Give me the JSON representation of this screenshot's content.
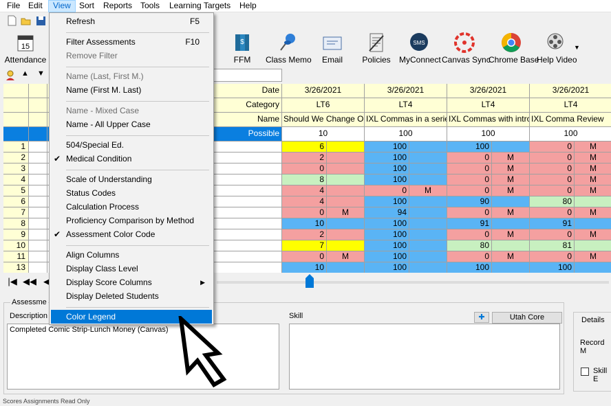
{
  "menubar": {
    "items": [
      {
        "label": "File",
        "active": false
      },
      {
        "label": "Edit",
        "active": false
      },
      {
        "label": "View",
        "active": true
      },
      {
        "label": "Sort",
        "active": false
      },
      {
        "label": "Reports",
        "active": false
      },
      {
        "label": "Tools",
        "active": false
      },
      {
        "label": "Learning Targets",
        "active": false
      },
      {
        "label": "Help",
        "active": false
      }
    ]
  },
  "toolbar": {
    "buttons": [
      {
        "label": "Attendance",
        "icon": "calendar-icon",
        "date": "15"
      },
      {
        "label": "FFM",
        "icon": "ffm-books-icon"
      },
      {
        "label": "Class Memo",
        "icon": "pushpin-icon"
      },
      {
        "label": "Email",
        "icon": "envelope-icon"
      },
      {
        "label": "Policies",
        "icon": "policies-icon"
      },
      {
        "label": "MyConnect",
        "icon": "sms-icon",
        "badge": "SMS"
      },
      {
        "label": "Canvas Sync",
        "icon": "canvas-icon"
      },
      {
        "label": "Chrome Base",
        "icon": "chrome-icon"
      },
      {
        "label": "Help Video",
        "icon": "film-reel-icon"
      }
    ]
  },
  "view_menu": {
    "items": [
      {
        "label": "Refresh",
        "shortcut": "F5",
        "disabled": false,
        "checked": false
      },
      {
        "label": "Filter  Assessments",
        "shortcut": "F10",
        "disabled": false,
        "checked": false
      },
      {
        "label": "Remove Filter",
        "disabled": true,
        "checked": false
      },
      {
        "label": "Name (Last, First M.)",
        "disabled": true,
        "checked": false
      },
      {
        "label": "Name (First M. Last)",
        "disabled": false,
        "checked": false
      },
      {
        "label": "Name - Mixed Case",
        "disabled": true,
        "checked": false
      },
      {
        "label": "Name - All Upper Case",
        "disabled": false,
        "checked": false
      },
      {
        "label": "504/Special Ed.",
        "disabled": false,
        "checked": false
      },
      {
        "label": "Medical Condition",
        "disabled": false,
        "checked": true
      },
      {
        "label": "Scale of Understanding",
        "disabled": false,
        "checked": false
      },
      {
        "label": "Status Codes",
        "disabled": false,
        "checked": false
      },
      {
        "label": "Calculation Process",
        "disabled": false,
        "checked": false
      },
      {
        "label": "Proficiency Comparison by Method",
        "disabled": false,
        "checked": false
      },
      {
        "label": "Assessment Color Code",
        "disabled": false,
        "checked": true
      },
      {
        "label": "Align Columns",
        "disabled": false,
        "checked": false
      },
      {
        "label": "Display Class Level",
        "disabled": false,
        "checked": false
      },
      {
        "label": "Display Score Columns",
        "disabled": false,
        "checked": false,
        "submenu": true
      },
      {
        "label": "Display Deleted Students",
        "disabled": false,
        "checked": false
      },
      {
        "label": "Color Legend",
        "disabled": false,
        "checked": false,
        "highlighted": true
      }
    ]
  },
  "grid": {
    "header_labels": {
      "date": "Date",
      "category": "Category",
      "name": "Name",
      "possible": "Possible"
    },
    "assessments": [
      {
        "date": "3/26/2021",
        "category": "LT6",
        "name": "Should We Change Our",
        "possible": "10"
      },
      {
        "date": "3/26/2021",
        "category": "LT4",
        "name": "IXL Commas in a series",
        "possible": "100"
      },
      {
        "date": "3/26/2021",
        "category": "LT4",
        "name": "IXL Commas with introdu",
        "possible": "100"
      },
      {
        "date": "3/26/2021",
        "category": "LT4",
        "name": "IXL Comma Review",
        "possible": "100"
      }
    ],
    "rows": [
      {
        "num": "1",
        "marker": "",
        "scores": [
          [
            "6",
            ""
          ],
          [
            "100",
            ""
          ],
          [
            "100",
            ""
          ],
          [
            "0",
            "M"
          ]
        ],
        "colors": [
          "yellow",
          "blue",
          "blue",
          "red"
        ]
      },
      {
        "num": "2",
        "marker": "",
        "scores": [
          [
            "2",
            ""
          ],
          [
            "100",
            ""
          ],
          [
            "0",
            "M"
          ],
          [
            "0",
            "M"
          ]
        ],
        "colors": [
          "red",
          "blue",
          "red",
          "red"
        ]
      },
      {
        "num": "3",
        "marker": "",
        "scores": [
          [
            "0",
            ""
          ],
          [
            "100",
            ""
          ],
          [
            "0",
            "M"
          ],
          [
            "0",
            "M"
          ]
        ],
        "colors": [
          "red",
          "blue",
          "red",
          "red"
        ]
      },
      {
        "num": "4",
        "marker": "",
        "scores": [
          [
            "8",
            ""
          ],
          [
            "100",
            ""
          ],
          [
            "0",
            "M"
          ],
          [
            "0",
            "M"
          ]
        ],
        "colors": [
          "green",
          "blue",
          "red",
          "red"
        ]
      },
      {
        "num": "5",
        "marker": "snowflake",
        "scores": [
          [
            "4",
            ""
          ],
          [
            "0",
            "M"
          ],
          [
            "0",
            "M"
          ],
          [
            "0",
            "M"
          ]
        ],
        "colors": [
          "red",
          "red",
          "red",
          "red"
        ]
      },
      {
        "num": "6",
        "marker": "",
        "scores": [
          [
            "4",
            ""
          ],
          [
            "100",
            ""
          ],
          [
            "90",
            ""
          ],
          [
            "80",
            ""
          ]
        ],
        "colors": [
          "red",
          "blue",
          "blue",
          "green"
        ]
      },
      {
        "num": "7",
        "marker": "",
        "scores": [
          [
            "0",
            "M"
          ],
          [
            "94",
            ""
          ],
          [
            "0",
            "M"
          ],
          [
            "0",
            "M"
          ]
        ],
        "colors": [
          "red",
          "blue",
          "red",
          "red"
        ]
      },
      {
        "num": "8",
        "marker": "",
        "scores": [
          [
            "10",
            ""
          ],
          [
            "100",
            ""
          ],
          [
            "91",
            ""
          ],
          [
            "91",
            ""
          ]
        ],
        "colors": [
          "blue",
          "blue",
          "blue",
          "blue"
        ]
      },
      {
        "num": "9",
        "marker": "",
        "scores": [
          [
            "2",
            ""
          ],
          [
            "100",
            ""
          ],
          [
            "0",
            "M"
          ],
          [
            "0",
            "M"
          ]
        ],
        "colors": [
          "red",
          "blue",
          "red",
          "red"
        ]
      },
      {
        "num": "10",
        "marker": "asterisk",
        "scores": [
          [
            "7",
            ""
          ],
          [
            "100",
            ""
          ],
          [
            "80",
            ""
          ],
          [
            "81",
            ""
          ]
        ],
        "colors": [
          "yellow",
          "blue",
          "green",
          "green"
        ]
      },
      {
        "num": "11",
        "marker": "",
        "scores": [
          [
            "0",
            "M"
          ],
          [
            "100",
            ""
          ],
          [
            "0",
            "M"
          ],
          [
            "0",
            "M"
          ]
        ],
        "colors": [
          "red",
          "blue",
          "red",
          "red"
        ]
      },
      {
        "num": "13",
        "marker": "",
        "scores": [
          [
            "10",
            ""
          ],
          [
            "100",
            ""
          ],
          [
            "100",
            ""
          ],
          [
            "100",
            ""
          ]
        ],
        "colors": [
          "blue",
          "blue",
          "blue",
          "blue"
        ]
      }
    ]
  },
  "colors": {
    "yellow": "#ffff00",
    "blue": "#5ab4f5",
    "red": "#f4a0a0",
    "green": "#c8f0c0",
    "highlight": "#0078d7",
    "header": "#ffffd5",
    "possible_row": "#0a7fe0"
  },
  "bottom": {
    "assessment_label": "Assessme",
    "description_label": "Description",
    "description_value": "Completed Comic Strip-Lunch Money (Canvas)",
    "skill_label": "Skill",
    "utah_core_button": "Utah Core",
    "details_label": "Details",
    "record_label": "Record M",
    "skill_checkbox_label": "Skill E"
  },
  "statusbar": {
    "text": "Scores Assignments Read Only"
  }
}
